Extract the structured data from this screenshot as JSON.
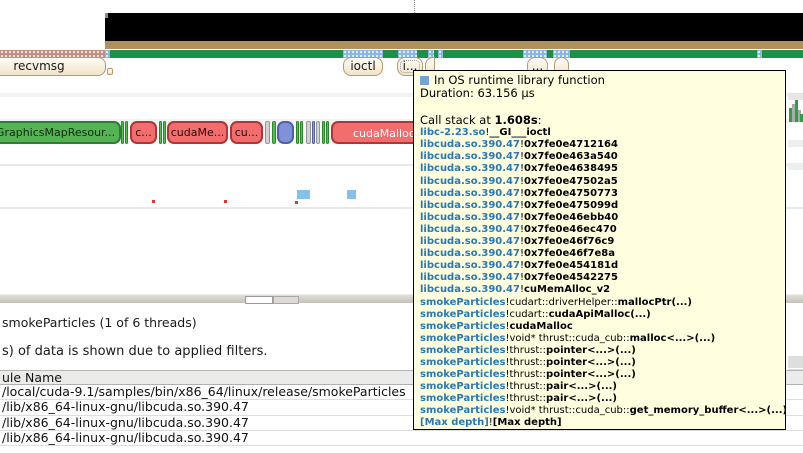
{
  "timeline": {
    "buttons": {
      "recvmsg": "recvmsg",
      "ioctl": "ioctl",
      "interrupted": "i...",
      "more": "..."
    },
    "segments": [
      {
        "label": "GraphicsMapResour...",
        "color": "green"
      },
      {
        "label": "c...",
        "color": "red"
      },
      {
        "label": "cudaMe...",
        "color": "red"
      },
      {
        "label": "cu...",
        "color": "red"
      },
      {
        "label": "",
        "color": "blue"
      },
      {
        "label": "cudaMalloc",
        "color": "red"
      }
    ]
  },
  "tooltip": {
    "title": "In OS runtime library function",
    "duration": "Duration: 63.156 μs",
    "callstack_prefix": "Call stack at ",
    "callstack_time": "1.608s",
    "callstack_suffix": ":",
    "frames": [
      {
        "m": "libc-2.23.so",
        "p": "",
        "b": "__GI___ioctl"
      },
      {
        "m": "libcuda.so.390.47",
        "p": "",
        "b": "0x7fe0e4712164"
      },
      {
        "m": "libcuda.so.390.47",
        "p": "",
        "b": "0x7fe0e463a540"
      },
      {
        "m": "libcuda.so.390.47",
        "p": "",
        "b": "0x7fe0e4638495"
      },
      {
        "m": "libcuda.so.390.47",
        "p": "",
        "b": "0x7fe0e47502a5"
      },
      {
        "m": "libcuda.so.390.47",
        "p": "",
        "b": "0x7fe0e4750773"
      },
      {
        "m": "libcuda.so.390.47",
        "p": "",
        "b": "0x7fe0e475099d"
      },
      {
        "m": "libcuda.so.390.47",
        "p": "",
        "b": "0x7fe0e46ebb40"
      },
      {
        "m": "libcuda.so.390.47",
        "p": "",
        "b": "0x7fe0e46ec470"
      },
      {
        "m": "libcuda.so.390.47",
        "p": "",
        "b": "0x7fe0e46f76c9"
      },
      {
        "m": "libcuda.so.390.47",
        "p": "",
        "b": "0x7fe0e46f7e8a"
      },
      {
        "m": "libcuda.so.390.47",
        "p": "",
        "b": "0x7fe0e454181d"
      },
      {
        "m": "libcuda.so.390.47",
        "p": "",
        "b": "0x7fe0e4542275"
      },
      {
        "m": "libcuda.so.390.47",
        "p": "",
        "b": "cuMemAlloc_v2"
      },
      {
        "m": "smokeParticles",
        "p": "cudart::driverHelper::",
        "b": "mallocPtr(...)"
      },
      {
        "m": "smokeParticles",
        "p": "cudart::",
        "b": "cudaApiMalloc(...)"
      },
      {
        "m": "smokeParticles",
        "p": "",
        "b": "cudaMalloc"
      },
      {
        "m": "smokeParticles",
        "p": "void* thrust::cuda_cub::",
        "b": "malloc<...>(...)"
      },
      {
        "m": "smokeParticles",
        "p": "thrust::",
        "b": "pointer<...>(...)"
      },
      {
        "m": "smokeParticles",
        "p": "thrust::",
        "b": "pointer<...>(...)"
      },
      {
        "m": "smokeParticles",
        "p": "thrust::",
        "b": "pointer<...>(...)"
      },
      {
        "m": "smokeParticles",
        "p": "thrust::",
        "b": "pair<...>(...)"
      },
      {
        "m": "smokeParticles",
        "p": "thrust::",
        "b": "pair<...>(...)"
      },
      {
        "m": "smokeParticles",
        "p": "void* thrust::cuda_cub::",
        "b": "get_memory_buffer<...>(...)"
      },
      {
        "m": "[Max depth]",
        "p": "",
        "b": "[Max depth]"
      }
    ]
  },
  "bottom": {
    "thread_label": "smokeParticles (1 of 6 threads)",
    "filter_notice": "s) of data is shown due to applied filters.",
    "table": {
      "header": "ule Name",
      "rows": [
        "/local/cuda-9.1/samples/bin/x86_64/linux/release/smokeParticles",
        "/lib/x86_64-linux-gnu/libcuda.so.390.47",
        "/lib/x86_64-linux-gnu/libcuda.so.390.47",
        "/lib/x86_64-linux-gnu/libcuda.so.390.47"
      ]
    }
  },
  "colors": {
    "timeline_green": "#1d9048",
    "timeline_tan": "#b0905e",
    "filtered_pattern": "#c4907e",
    "interval_blue": "#8cb6ea",
    "segment_green": "#55b355",
    "segment_red": "#f26d6d",
    "segment_blue": "#8091d8",
    "module_blue": "#2878b8",
    "tooltip_bg": "#ffffdf",
    "legend_blue": "#74a3d4"
  }
}
